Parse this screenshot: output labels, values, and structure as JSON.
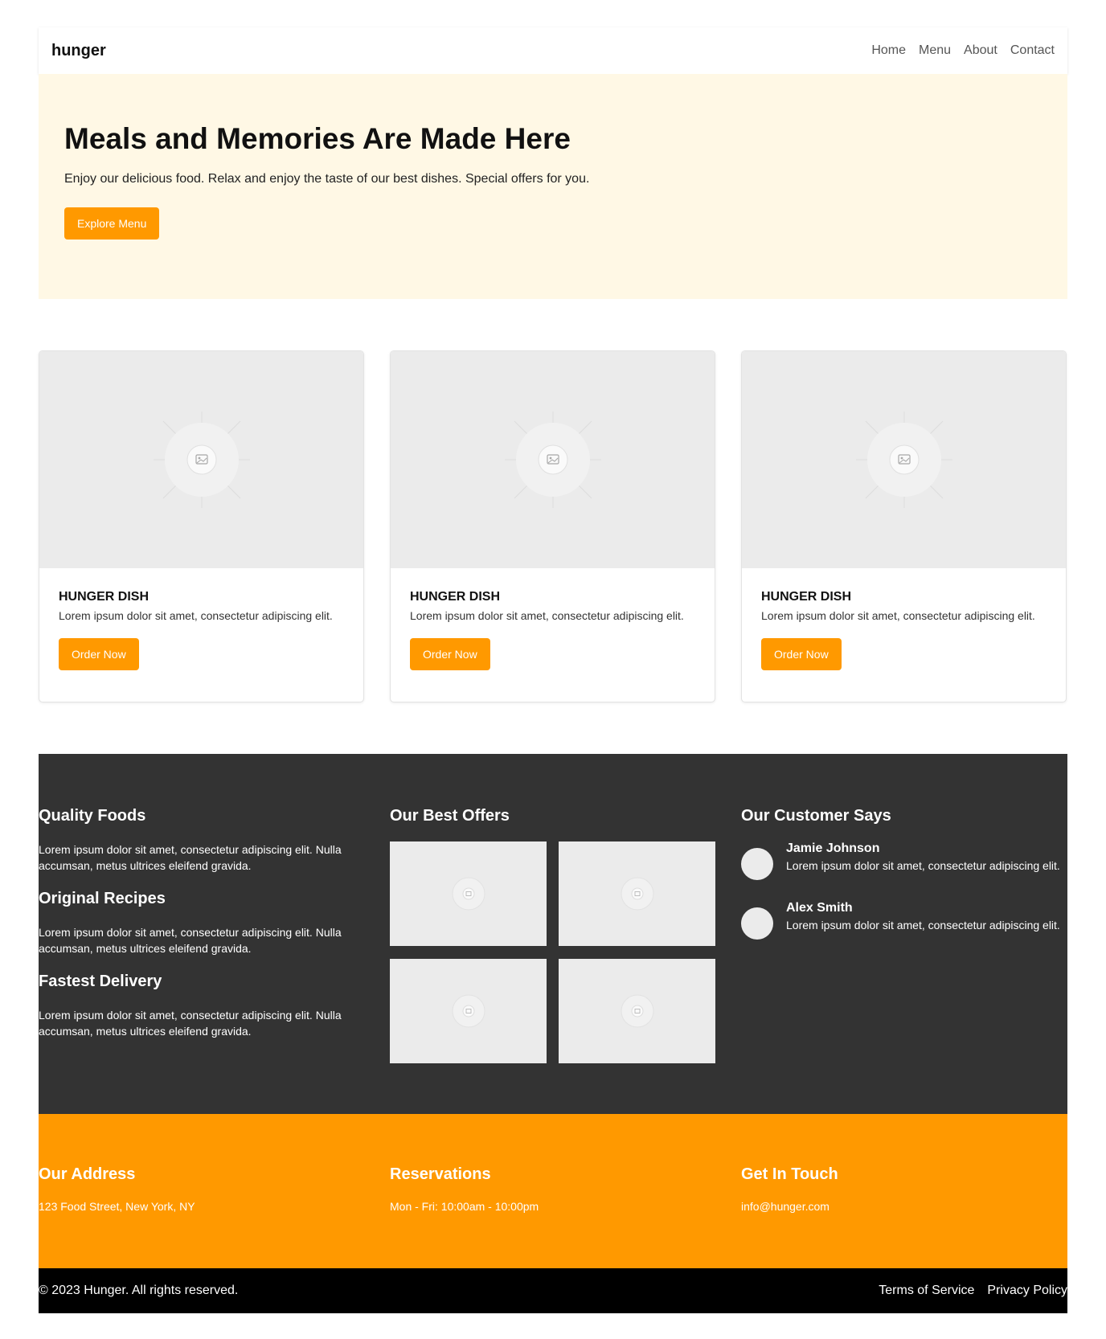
{
  "nav": {
    "brand": "hunger",
    "links": [
      "Home",
      "Menu",
      "About",
      "Contact"
    ]
  },
  "hero": {
    "title": "Meals and Memories Are Made Here",
    "subtitle": "Enjoy our delicious food. Relax and enjoy the taste of our best dishes. Special offers for you.",
    "button": "Explore Menu"
  },
  "cards": [
    {
      "title": "HUNGER DISH",
      "text": "Lorem ipsum dolor sit amet, consectetur adipiscing elit.",
      "button": "Order Now"
    },
    {
      "title": "HUNGER DISH",
      "text": "Lorem ipsum dolor sit amet, consectetur adipiscing elit.",
      "button": "Order Now"
    },
    {
      "title": "HUNGER DISH",
      "text": "Lorem ipsum dolor sit amet, consectetur adipiscing elit.",
      "button": "Order Now"
    }
  ],
  "features": [
    {
      "title": "Quality Foods",
      "text": "Lorem ipsum dolor sit amet, consectetur adipiscing elit. Nulla accumsan, metus ultrices eleifend gravida."
    },
    {
      "title": "Original Recipes",
      "text": "Lorem ipsum dolor sit amet, consectetur adipiscing elit. Nulla accumsan, metus ultrices eleifend gravida."
    },
    {
      "title": "Fastest Delivery",
      "text": "Lorem ipsum dolor sit amet, consectetur adipiscing elit. Nulla accumsan, metus ultrices eleifend gravida."
    }
  ],
  "offers": {
    "title": "Our Best Offers"
  },
  "testimonials": {
    "title": "Our Customer Says",
    "items": [
      {
        "name": "Jamie Johnson",
        "text": "Lorem ipsum dolor sit amet, consectetur adipiscing elit."
      },
      {
        "name": "Alex Smith",
        "text": "Lorem ipsum dolor sit amet, consectetur adipiscing elit."
      }
    ]
  },
  "contact": [
    {
      "title": "Our Address",
      "text": "123 Food Street, New York, NY"
    },
    {
      "title": "Reservations",
      "text": "Mon - Fri: 10:00am - 10:00pm"
    },
    {
      "title": "Get In Touch",
      "text": "info@hunger.com"
    }
  ],
  "footer": {
    "copyright": "© 2023 Hunger. All rights reserved.",
    "links": [
      "Terms of Service",
      "Privacy Policy"
    ]
  },
  "colors": {
    "accent": "#ff9900",
    "hero_bg": "#fff8e5",
    "dark_bg": "#333333",
    "footer_bg": "#000000",
    "placeholder": "#ebebeb"
  }
}
